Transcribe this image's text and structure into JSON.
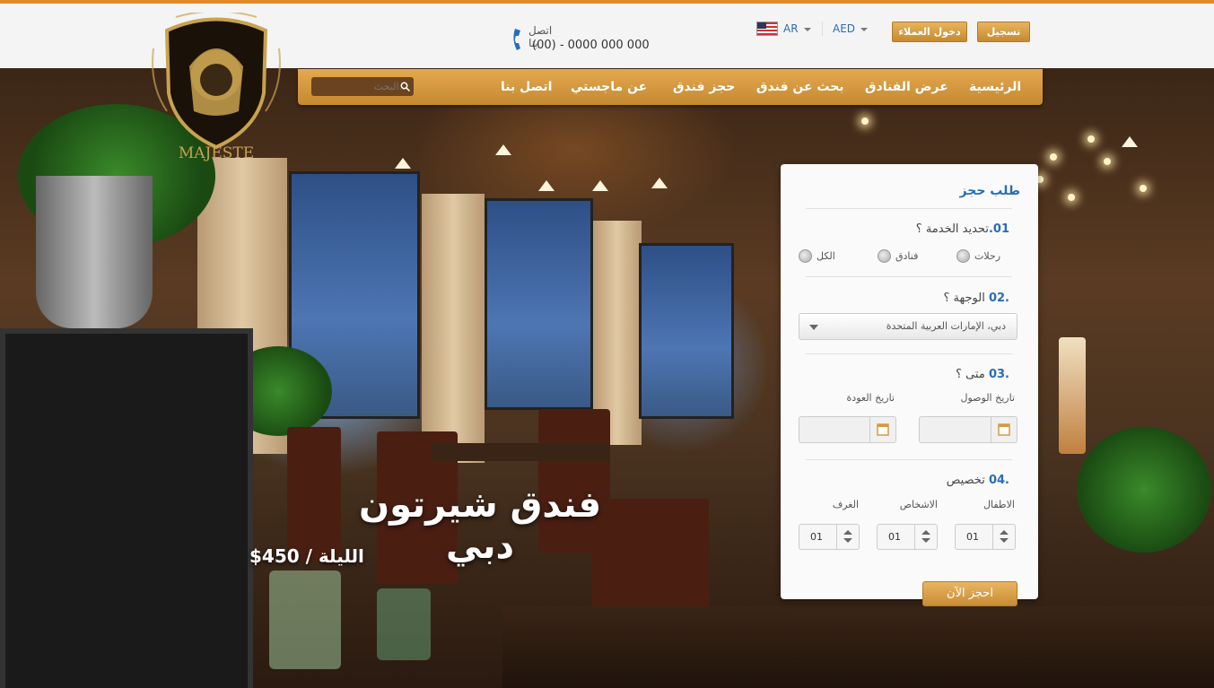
{
  "header": {
    "contact_label": "اتصل بنا",
    "contact_phone": "(00) - 0000 000 000",
    "language": "AR",
    "currency": "AED",
    "login_label": "دخول العملاء",
    "register_label": "تسجيل"
  },
  "logo": {
    "text": "MAJESTE"
  },
  "nav": {
    "items": [
      "الرئيسية",
      "عرض الفنادق",
      "بحث عن فندق",
      "حجز فندق",
      "عن ماجستي",
      "اتصل بنا"
    ],
    "search_placeholder": "...البحث"
  },
  "hero": {
    "title": "فندق شيرتون دبي",
    "price": "$450 / الليلة"
  },
  "booking": {
    "title": "طلب حجز",
    "s1_num": "01.",
    "s1_label": "تحديد الخدمة ؟",
    "radios": [
      "رحلات",
      "فنادق",
      "الكل"
    ],
    "s2_num": ".02",
    "s2_label": " الوجهة ؟",
    "destination": "دبي، الإمارات العربية المتحدة",
    "s3_num": ".03",
    "s3_label": " متى ؟",
    "arrival_label": "تاريخ الوصول",
    "return_label": "تاريخ العودة",
    "s4_num": ".04",
    "s4_label": " تخصيص",
    "children_label": "الاطفال",
    "persons_label": "الاشخاص",
    "rooms_label": "الغرف",
    "children_value": "01",
    "persons_value": "01",
    "rooms_value": "01",
    "book_now": "احجز الآن"
  },
  "colors": {
    "accent": "#e08a2c",
    "gold": "#d49a42",
    "link": "#2a6db3"
  }
}
